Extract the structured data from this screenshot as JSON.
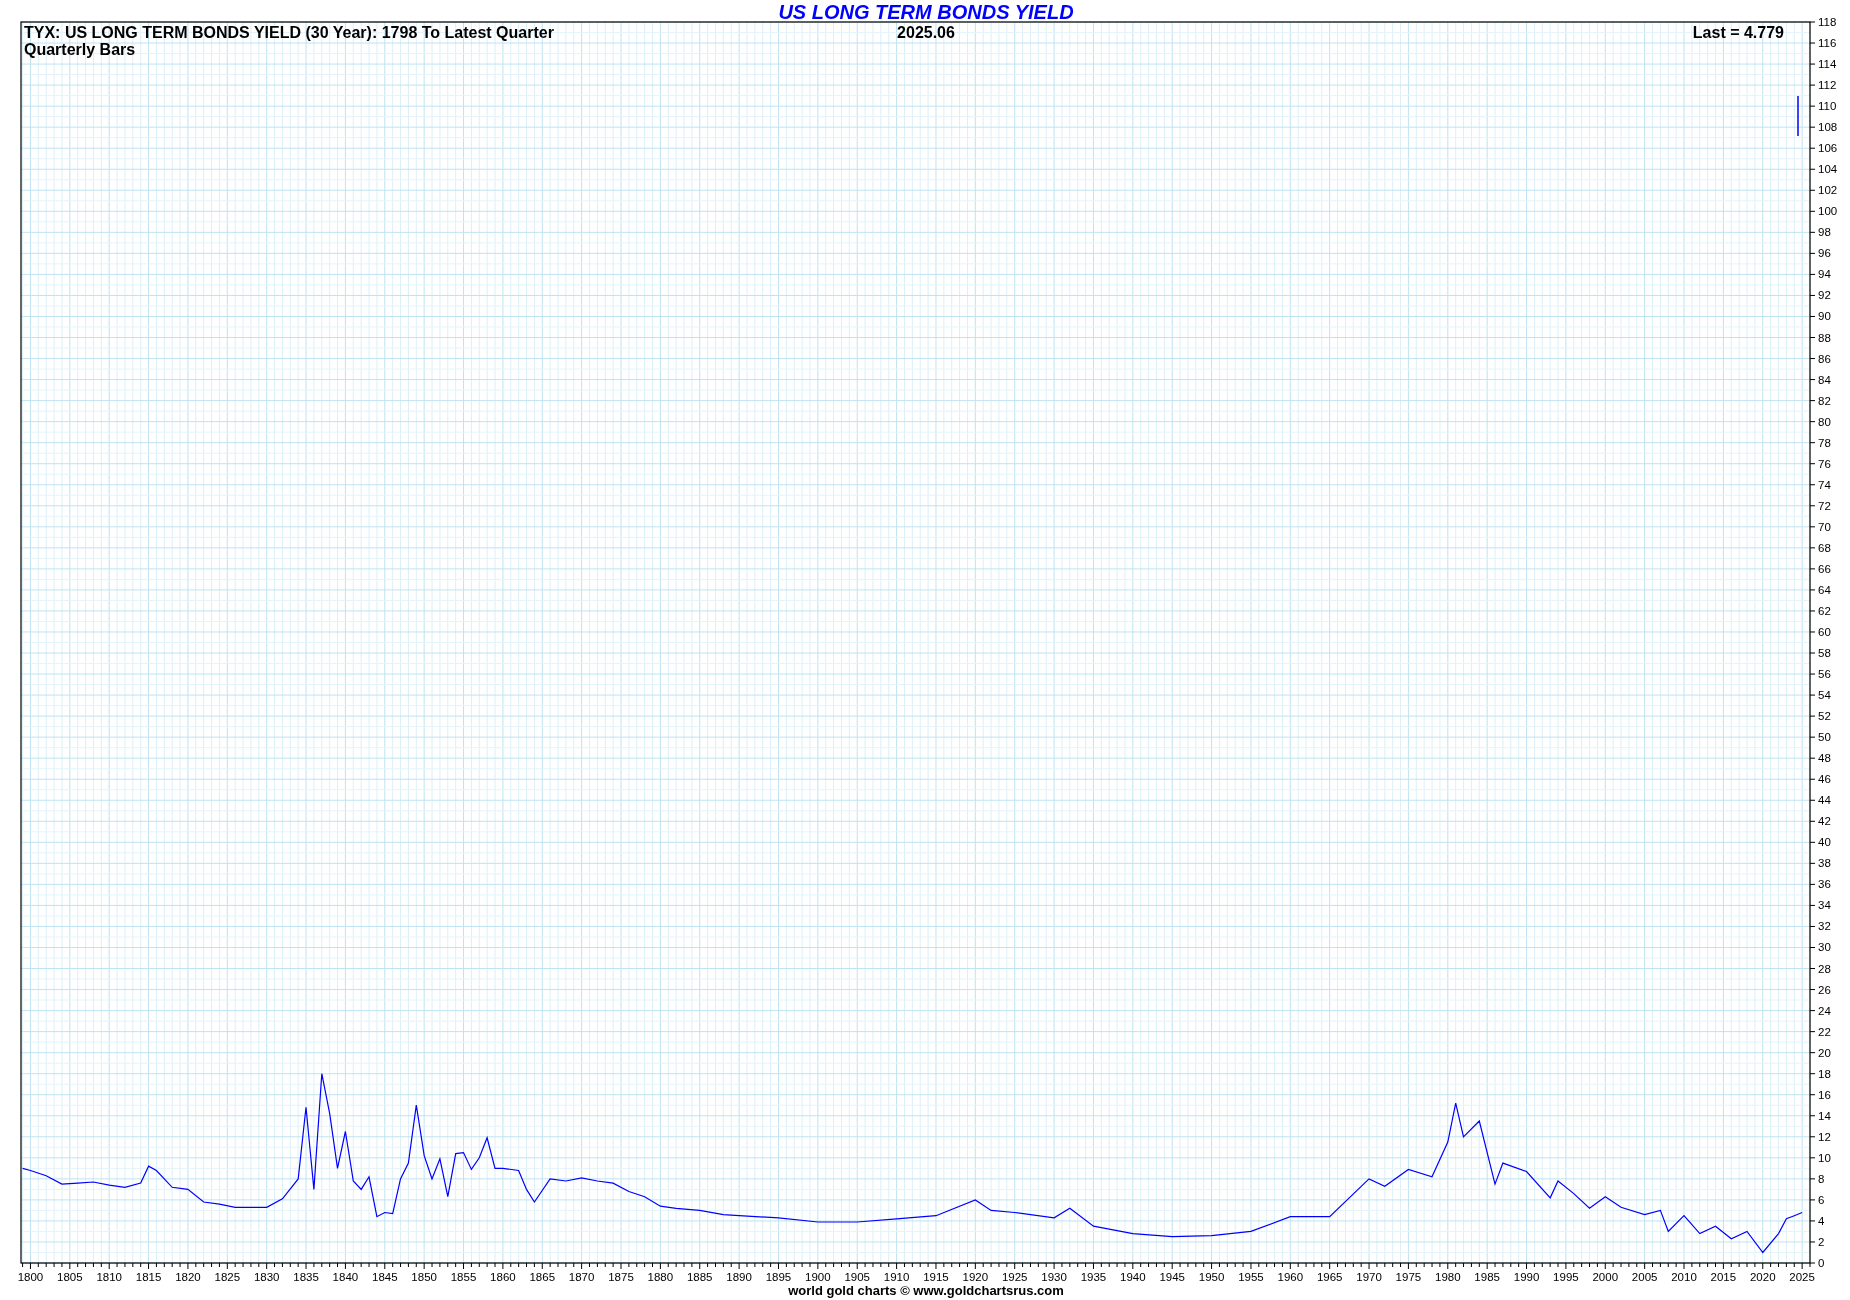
{
  "header": {
    "subtitle": "TYX: US LONG TERM BONDS YIELD (30 Year): 1798 To Latest Quarter",
    "bar_type": "Quarterly Bars",
    "date": "2025.06",
    "last": "Last = 4.779"
  },
  "chart_data": {
    "type": "line",
    "title": "US LONG TERM BONDS YIELD",
    "xlim": [
      1798.8,
      2026
    ],
    "ylim": [
      0,
      118
    ],
    "grid": true,
    "x": [
      1799,
      1800,
      1802,
      1804,
      1806,
      1808,
      1810,
      1812,
      1814,
      1815,
      1816,
      1818,
      1820,
      1822,
      1824,
      1826,
      1828,
      1830,
      1832,
      1834,
      1835,
      1836,
      1837,
      1838,
      1839,
      1840,
      1841,
      1842,
      1843,
      1844,
      1845,
      1846,
      1847,
      1848,
      1849,
      1850,
      1851,
      1852,
      1853,
      1854,
      1855,
      1856,
      1857,
      1858,
      1859,
      1860,
      1862,
      1863,
      1864,
      1866,
      1868,
      1870,
      1872,
      1874,
      1876,
      1878,
      1880,
      1882,
      1885,
      1888,
      1890,
      1895,
      1900,
      1905,
      1910,
      1915,
      1920,
      1922,
      1925,
      1930,
      1932,
      1935,
      1940,
      1945,
      1950,
      1955,
      1960,
      1965,
      1970,
      1972,
      1975,
      1978,
      1980,
      1981,
      1982,
      1984,
      1986,
      1987,
      1990,
      1993,
      1994,
      1996,
      1998,
      2000,
      2002,
      2005,
      2007,
      2008,
      2010,
      2012,
      2014,
      2016,
      2018,
      2020,
      2022,
      2023,
      2024,
      2025
    ],
    "series": [
      {
        "color": "#0000ff",
        "values": [
          9.0,
          8.8,
          8.3,
          7.5,
          7.6,
          7.7,
          7.4,
          7.2,
          7.6,
          9.2,
          8.8,
          7.2,
          7.0,
          5.8,
          5.6,
          5.3,
          5.3,
          5.3,
          6.1,
          8.0,
          14.8,
          7.0,
          18.0,
          14.2,
          9.0,
          12.5,
          7.8,
          7.0,
          8.2,
          4.4,
          4.8,
          4.7,
          8.0,
          9.5,
          15.0,
          10.2,
          8.0,
          9.9,
          6.3,
          10.4,
          10.5,
          8.9,
          10.0,
          11.9,
          9.0,
          9.0,
          8.8,
          7.0,
          5.8,
          8.0,
          7.8,
          8.1,
          7.8,
          7.6,
          6.8,
          6.3,
          5.4,
          5.2,
          5.0,
          4.6,
          4.5,
          4.3,
          3.9,
          3.9,
          4.2,
          4.5,
          6.0,
          5.0,
          4.8,
          4.3,
          5.2,
          3.5,
          2.8,
          2.5,
          2.6,
          3.0,
          4.4,
          4.4,
          8.0,
          7.3,
          8.9,
          8.2,
          11.5,
          15.2,
          12.0,
          13.5,
          7.5,
          9.5,
          8.7,
          6.2,
          7.8,
          6.6,
          5.2,
          6.3,
          5.3,
          4.6,
          5.0,
          3.0,
          4.5,
          2.8,
          3.5,
          2.3,
          3.0,
          1.0,
          2.8,
          4.2,
          4.5,
          4.8
        ]
      }
    ],
    "xticks": [
      1800,
      1805,
      1810,
      1815,
      1820,
      1825,
      1830,
      1835,
      1840,
      1845,
      1850,
      1855,
      1860,
      1865,
      1870,
      1875,
      1880,
      1885,
      1890,
      1895,
      1900,
      1905,
      1910,
      1915,
      1920,
      1925,
      1930,
      1935,
      1940,
      1945,
      1950,
      1955,
      1960,
      1965,
      1970,
      1975,
      1980,
      1985,
      1990,
      1995,
      2000,
      2005,
      2010,
      2015,
      2020,
      2025
    ],
    "yticks": [
      0,
      2,
      4,
      6,
      8,
      10,
      12,
      14,
      16,
      18,
      20,
      22,
      24,
      26,
      28,
      30,
      32,
      34,
      36,
      38,
      40,
      42,
      44,
      46,
      48,
      50,
      52,
      54,
      56,
      58,
      60,
      62,
      64,
      66,
      68,
      70,
      72,
      74,
      76,
      78,
      80,
      82,
      84,
      86,
      88,
      90,
      92,
      94,
      96,
      98,
      100,
      102,
      104,
      106,
      108,
      110,
      112,
      114,
      116,
      118
    ]
  },
  "footer": "world gold charts © www.goldchartsrus.com"
}
